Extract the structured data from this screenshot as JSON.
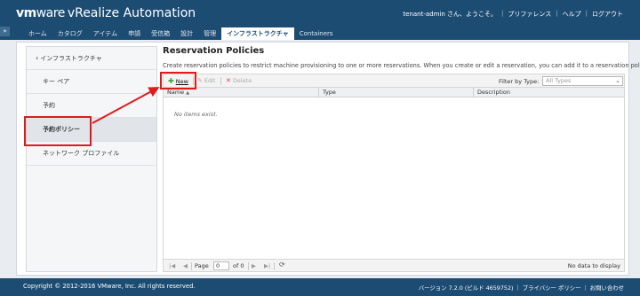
{
  "header": {
    "logo_vm": "vm",
    "logo_ware": "ware",
    "logo_product": "vRealize",
    "logo_suffix": "Automation",
    "user": "tenant-admin さん、ようこそ。",
    "links": [
      "プリファレンス",
      "ヘルプ",
      "ログアウト"
    ]
  },
  "collapse_icon": "»",
  "tabs": [
    {
      "label": "ホーム",
      "active": false
    },
    {
      "label": "カタログ",
      "active": false
    },
    {
      "label": "アイテム",
      "active": false
    },
    {
      "label": "申請",
      "active": false
    },
    {
      "label": "受信箱",
      "active": false
    },
    {
      "label": "設計",
      "active": false
    },
    {
      "label": "管理",
      "active": false
    },
    {
      "label": "インフラストラクチャ",
      "active": true
    },
    {
      "label": "Containers",
      "active": false
    }
  ],
  "sidebar": {
    "back_label": "インフラストラクチャ",
    "items": [
      {
        "label": "キー ペア",
        "selected": false
      },
      {
        "label": "予約",
        "selected": false
      },
      {
        "label": "予約ポリシー",
        "selected": true
      },
      {
        "label": "ネットワーク プロファイル",
        "selected": false
      }
    ]
  },
  "main": {
    "title": "Reservation Policies",
    "description": "Create reservation policies to restrict machine provisioning to one or more reservations. When you create or edit a reservation, you can add it to a reservation policy.",
    "toolbar": {
      "new_label": "New",
      "edit_label": "Edit",
      "delete_label": "Delete",
      "filter_label": "Filter by Type:",
      "filter_placeholder": "All Types"
    },
    "grid": {
      "columns": [
        "Name",
        "Type",
        "Description"
      ],
      "rows": [],
      "empty_text": "No items exist."
    },
    "pager": {
      "page_label": "Page",
      "page_value": "0",
      "of_label": "of 0",
      "status": "No data to display"
    }
  },
  "footer": {
    "copyright": "Copyright © 2012-2016 VMware, Inc. All rights reserved.",
    "version": "バージョン 7.2.0 (ビルド 4659752)",
    "privacy": "プライバシー ポリシー",
    "contact": "お問い合わせ"
  },
  "colors": {
    "header_bg": "#1d4c73",
    "highlight": "#e01b1b",
    "new_icon": "#3aa33a"
  }
}
